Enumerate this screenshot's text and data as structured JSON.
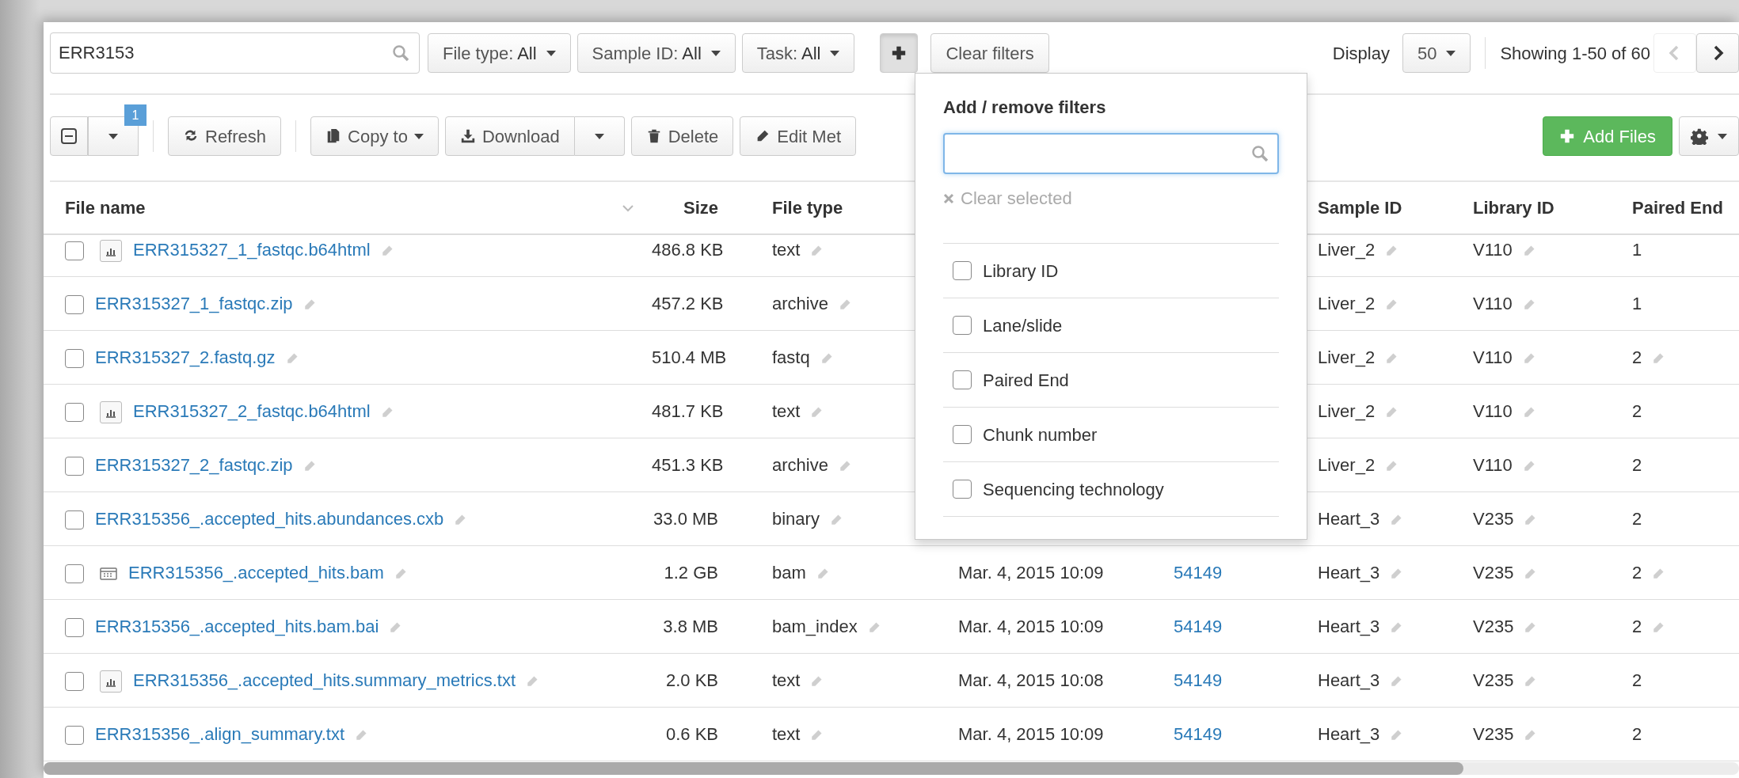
{
  "search": {
    "value": "ERR3153"
  },
  "filters": [
    {
      "label": "File type:",
      "value": "All"
    },
    {
      "label": "Sample ID:",
      "value": "All"
    },
    {
      "label": "Task:",
      "value": "All"
    }
  ],
  "add_filter": {
    "expanded": true
  },
  "clear_filters": "Clear filters",
  "display": {
    "label": "Display",
    "value": "50"
  },
  "pagination": {
    "text": "Showing 1-50 of 60",
    "prev_disabled": true,
    "next_disabled": false
  },
  "selection": {
    "count": "1"
  },
  "actions": [
    {
      "kind": "refresh",
      "label": "Refresh"
    },
    {
      "kind": "copy",
      "label": "Copy to"
    },
    {
      "kind": "download",
      "label": "Download"
    },
    {
      "kind": "delete",
      "label": "Delete"
    },
    {
      "kind": "edit",
      "label": "Edit Met"
    }
  ],
  "add_files": "Add Files",
  "columns": {
    "file_name": "File name",
    "size": "Size",
    "file_type": "File type",
    "sample_id": "Sample ID",
    "library_id": "Library ID",
    "paired_end": "Paired End"
  },
  "rows": [
    {
      "checked": false,
      "kind": "chart",
      "name": "ERR315327_1_fastqc.b64html",
      "size": "486.8 KB",
      "file_type": "text",
      "sample": "Liver_2",
      "library": "V110",
      "paired_end": "1",
      "paired_end_editable": false
    },
    {
      "checked": false,
      "name": "ERR315327_1_fastqc.zip",
      "size": "457.2 KB",
      "file_type": "archive",
      "sample": "Liver_2",
      "library": "V110",
      "paired_end": "1",
      "paired_end_editable": false
    },
    {
      "checked": false,
      "name": "ERR315327_2.fastq.gz",
      "size": "510.4 MB",
      "file_type": "fastq",
      "sample": "Liver_2",
      "library": "V110",
      "paired_end": "2",
      "paired_end_editable": true
    },
    {
      "checked": false,
      "kind": "chart",
      "name": "ERR315327_2_fastqc.b64html",
      "size": "481.7 KB",
      "file_type": "text",
      "sample": "Liver_2",
      "library": "V110",
      "paired_end": "2",
      "paired_end_editable": false
    },
    {
      "checked": false,
      "name": "ERR315327_2_fastqc.zip",
      "size": "451.3 KB",
      "file_type": "archive",
      "sample": "Liver_2",
      "library": "V110",
      "paired_end": "2",
      "paired_end_editable": false
    },
    {
      "checked": false,
      "name": "ERR315356_.accepted_hits.abundances.cxb",
      "size": "33.0 MB",
      "file_type": "binary",
      "sample": "Heart_3",
      "library": "V235",
      "paired_end": "2",
      "paired_end_editable": false
    },
    {
      "checked": false,
      "kind": "table",
      "name": "ERR315356_.accepted_hits.bam",
      "size": "1.2 GB",
      "file_type": "bam",
      "date": "Mar. 4, 2015 10:09",
      "task": "54149",
      "sample": "Heart_3",
      "library": "V235",
      "paired_end": "2",
      "paired_end_editable": true
    },
    {
      "checked": false,
      "name": "ERR315356_.accepted_hits.bam.bai",
      "size": "3.8 MB",
      "file_type": "bam_index",
      "date": "Mar. 4, 2015 10:09",
      "task": "54149",
      "sample": "Heart_3",
      "library": "V235",
      "paired_end": "2",
      "paired_end_editable": true
    },
    {
      "checked": false,
      "kind": "chart",
      "name": "ERR315356_.accepted_hits.summary_metrics.txt",
      "size": "2.0 KB",
      "file_type": "text",
      "date": "Mar. 4, 2015 10:08",
      "task": "54149",
      "sample": "Heart_3",
      "library": "V235",
      "paired_end": "2",
      "paired_end_editable": false
    },
    {
      "checked": false,
      "name": "ERR315356_.align_summary.txt",
      "size": "0.6 KB",
      "file_type": "text",
      "date": "Mar. 4, 2015 10:09",
      "task": "54149",
      "sample": "Heart_3",
      "library": "V235",
      "paired_end": "2",
      "paired_end_editable": false
    }
  ],
  "filter_menu": {
    "title": "Add / remove filters",
    "clear": "Clear selected",
    "items": [
      {
        "label": "Library ID",
        "checked": false
      },
      {
        "label": "Lane/slide",
        "checked": false
      },
      {
        "label": "Paired End",
        "checked": false
      },
      {
        "label": "Chunk number",
        "checked": false
      },
      {
        "label": "Sequencing technology",
        "checked": false
      }
    ]
  }
}
